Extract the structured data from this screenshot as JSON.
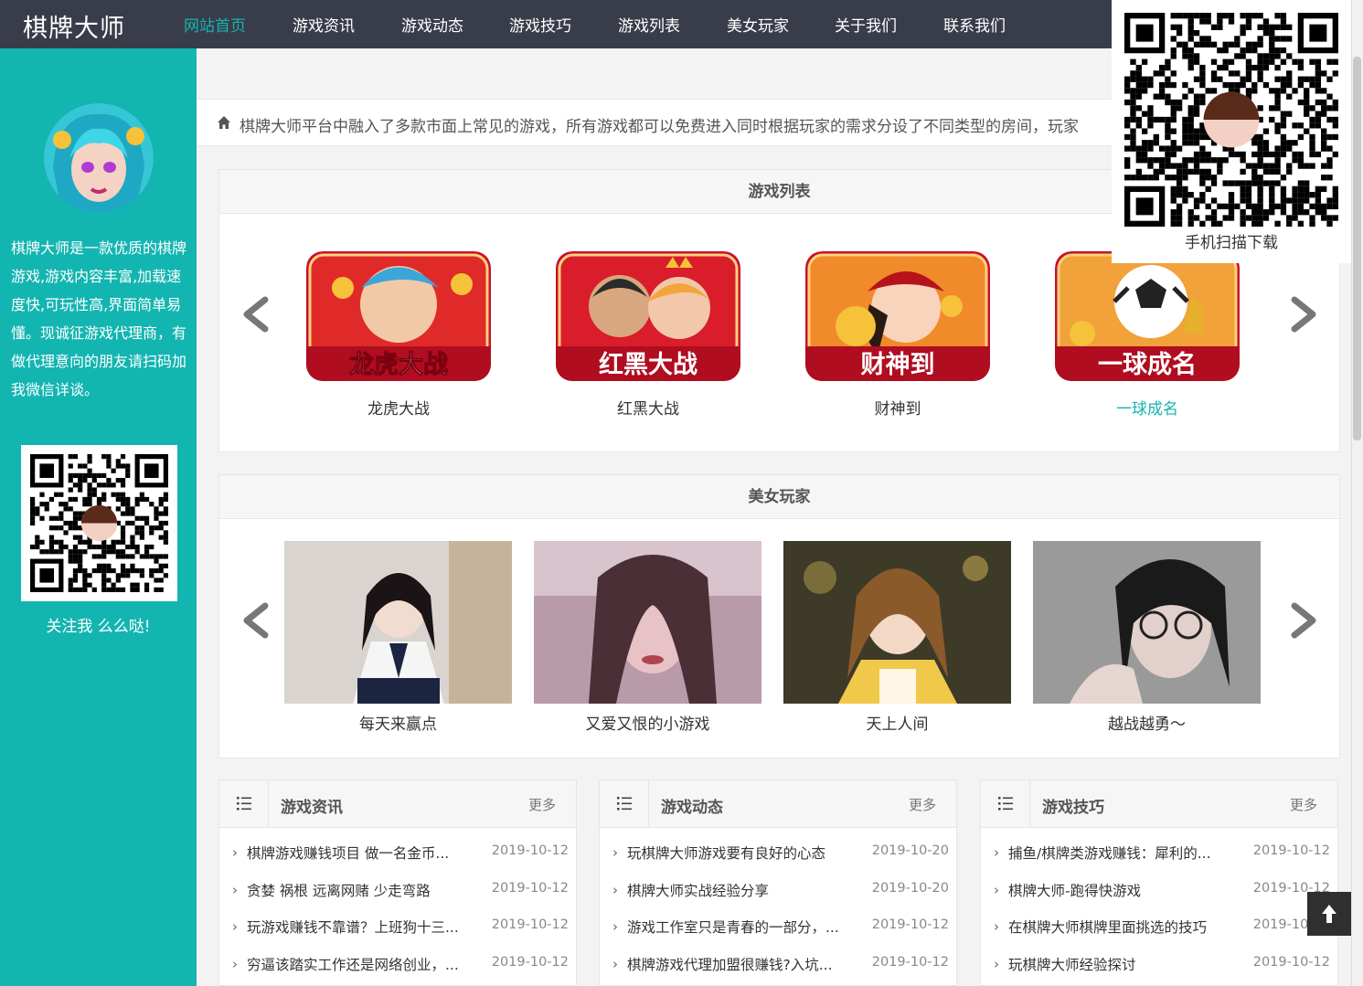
{
  "site": {
    "logo": "棋牌大师"
  },
  "nav": {
    "items": [
      {
        "label": "网站首页",
        "active": true
      },
      {
        "label": "游戏资讯"
      },
      {
        "label": "游戏动态"
      },
      {
        "label": "游戏技巧"
      },
      {
        "label": "游戏列表"
      },
      {
        "label": "美女玩家"
      },
      {
        "label": "关于我们"
      },
      {
        "label": "联系我们"
      }
    ]
  },
  "sidebar": {
    "intro": "棋牌大师是一款优质的棋牌游戏,游戏内容丰富,加载速度快,可玩性高,界面简单易懂。现诚征游戏代理商，有做代理意向的朋友请扫码加我微信详谈。",
    "follow": "关注我 么么哒!"
  },
  "notice": {
    "text": "棋牌大师平台中融入了多款市面上常见的游戏，所有游戏都可以免费进入同时根据玩家的需求分设了不同类型的房间，玩家"
  },
  "games": {
    "title": "游戏列表",
    "items": [
      {
        "name": "龙虎大战",
        "banner": "龙虎大战"
      },
      {
        "name": "红黑大战",
        "banner": "红黑大战"
      },
      {
        "name": "财神到",
        "banner": "财神到"
      },
      {
        "name": "一球成名",
        "banner": "一球成名",
        "highlight": true
      }
    ]
  },
  "players": {
    "title": "美女玩家",
    "items": [
      {
        "caption": "每天来赢点"
      },
      {
        "caption": "又爱又恨的小游戏"
      },
      {
        "caption": "天上人间"
      },
      {
        "caption": "越战越勇～"
      }
    ]
  },
  "news": [
    {
      "title": "游戏资讯",
      "more": "更多",
      "items": [
        {
          "t": "棋牌游戏赚钱项目 做一名金币...",
          "d": "2019-10-12"
        },
        {
          "t": "贪婪 祸根 远离网赌 少走弯路",
          "d": "2019-10-12"
        },
        {
          "t": "玩游戏赚钱不靠谱？上班狗十三...",
          "d": "2019-10-12"
        },
        {
          "t": "穷逼该踏实工作还是网络创业，...",
          "d": "2019-10-12"
        }
      ]
    },
    {
      "title": "游戏动态",
      "more": "更多",
      "items": [
        {
          "t": "玩棋牌大师游戏要有良好的心态",
          "d": "2019-10-20"
        },
        {
          "t": "棋牌大师实战经验分享",
          "d": "2019-10-20"
        },
        {
          "t": "游戏工作室只是青春的一部分，...",
          "d": "2019-10-12"
        },
        {
          "t": "棋牌游戏代理加盟很赚钱?入坑...",
          "d": "2019-10-12"
        }
      ]
    },
    {
      "title": "游戏技巧",
      "more": "更多",
      "items": [
        {
          "t": "捕鱼/棋牌类游戏赚钱：犀利的...",
          "d": "2019-10-12"
        },
        {
          "t": "棋牌大师-跑得快游戏",
          "d": "2019-10-12"
        },
        {
          "t": "在棋牌大师棋牌里面挑选的技巧",
          "d": "2019-10-12"
        },
        {
          "t": "玩棋牌大师经验探讨",
          "d": "2019-10-12"
        }
      ]
    }
  ],
  "float_qr": {
    "caption": "手机扫描下载"
  },
  "colors": {
    "accent": "#13b5b1",
    "nav_bg": "#393d49",
    "game_red": "#c8102e"
  }
}
